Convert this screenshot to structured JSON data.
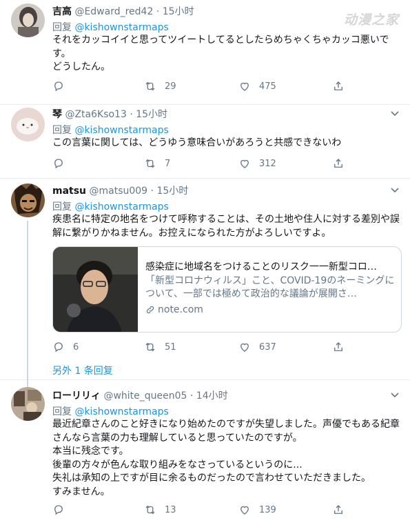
{
  "watermark": "动漫之家",
  "tweets": [
    {
      "name": "吉高",
      "handle": "@Edward_red42",
      "time": "· 15小时",
      "reply_prefix": "回复",
      "reply_to": "@kishownstarmaps",
      "text": "それをカッコイイと思ってツイートしてるとしたらめちゃくちゃカッコ悪いです。\nどうしたん。",
      "replies": "",
      "retweets": "29",
      "likes": "475"
    },
    {
      "name": "琴",
      "handle": "@Zta6Kso13",
      "time": "· 15小时",
      "reply_prefix": "回复",
      "reply_to": "@kishownstarmaps",
      "text": "この言葉に関しては、どうゆう意味合いがあろうと共感できないわ",
      "replies": "",
      "retweets": "7",
      "likes": "312"
    },
    {
      "name": "matsu",
      "handle": "@matsu009",
      "time": "· 15小时",
      "reply_prefix": "回复",
      "reply_to": "@kishownstarmaps",
      "text": "疾患名に特定の地名をつけて呼称することは、その土地や住人に対する差別や誤解に繋がりかねません。お控えになられた方がよろしいですよ。",
      "card": {
        "title": "感染症に地域名をつけることのリスク一一新型コロ…",
        "description": "「新型コロナウィルス」こと、COVID-19のネーミングについて、一部では極めて政治的な議論が展開さ…",
        "domain": "note.com"
      },
      "replies": "6",
      "retweets": "51",
      "likes": "637"
    },
    {
      "name": "ローリリィ",
      "handle": "@white_queen05",
      "time": "· 14小时",
      "reply_prefix": "回复",
      "reply_to": "@kishownstarmaps",
      "text": "最近紀章さんのこと好きになり始めたのですが失望しました。声優でもある紀章さんなら言葉の力も理解していると思っていたのですが。\n本当に残念です。\n後輩の方々が色んな取り組みをなさっているというのに...\n失礼は承知の上ですが目に余るものだったので言わせていただきました。\nすみません。",
      "replies": "",
      "retweets": "13",
      "likes": "139"
    }
  ],
  "show_more": "另外 1 条回复",
  "colors": {
    "link": "#1b95e0",
    "muted": "#657786",
    "text": "#14171a",
    "border": "#e6ecf0"
  },
  "icons": [
    "chevron-down-icon",
    "reply-icon",
    "retweet-icon",
    "like-icon",
    "share-icon",
    "link-icon"
  ]
}
